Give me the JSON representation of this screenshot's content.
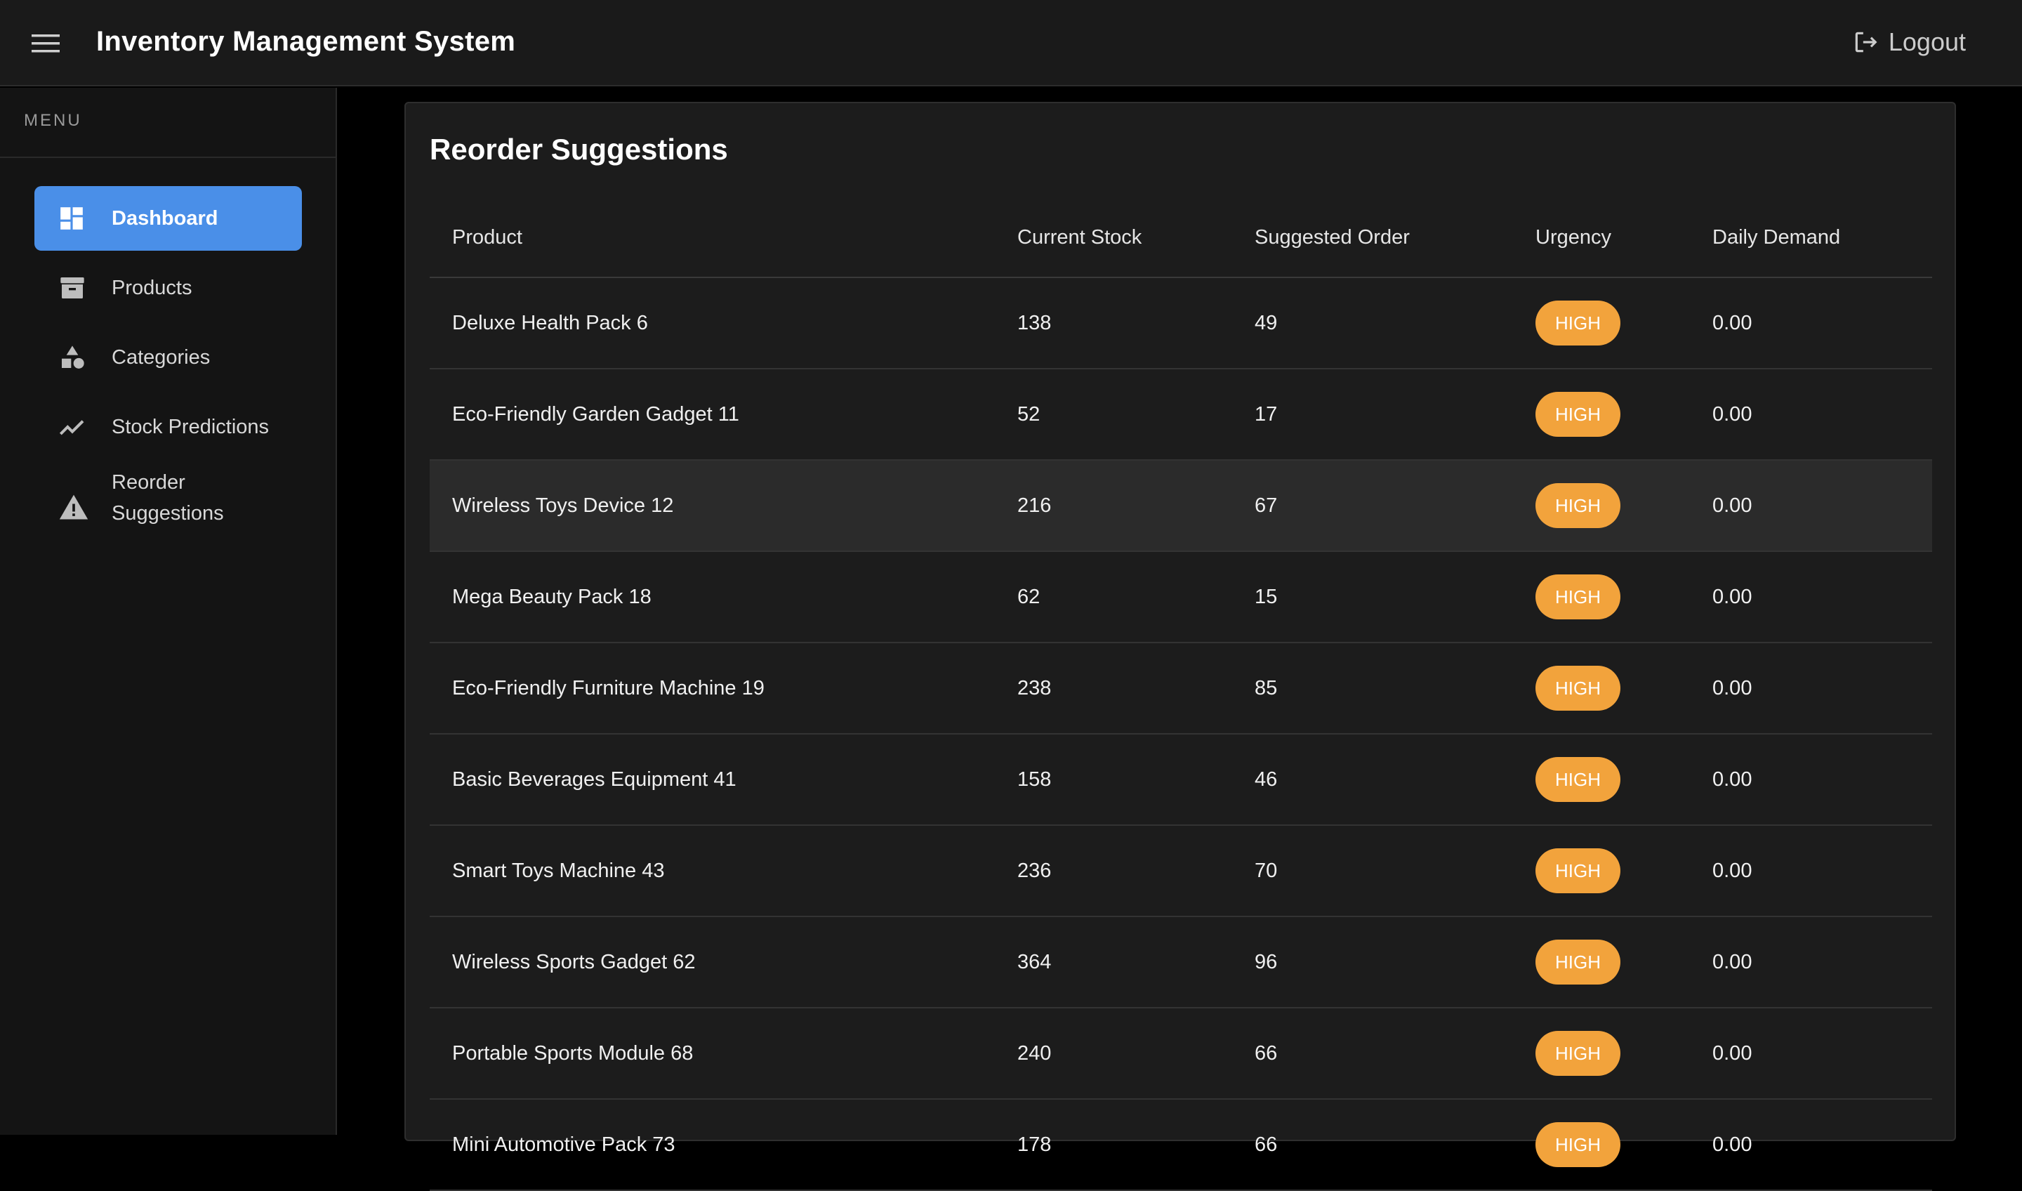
{
  "app": {
    "title": "Inventory Management System",
    "logout_label": "Logout"
  },
  "sidebar": {
    "header": "MENU",
    "items": [
      {
        "label": "Dashboard",
        "icon": "dashboard-icon",
        "active": true
      },
      {
        "label": "Products",
        "icon": "archive-box-icon",
        "active": false
      },
      {
        "label": "Categories",
        "icon": "shapes-icon",
        "active": false
      },
      {
        "label": "Stock Predictions",
        "icon": "trend-line-icon",
        "active": false
      },
      {
        "label": "Reorder Suggestions",
        "icon": "warning-icon",
        "active": false
      }
    ]
  },
  "main": {
    "card_title": "Reorder Suggestions",
    "columns": [
      "Product",
      "Current Stock",
      "Suggested Order",
      "Urgency",
      "Daily Demand"
    ],
    "rows": [
      {
        "product": "Deluxe Health Pack 6",
        "stock": "138",
        "order": "49",
        "urgency": "HIGH",
        "demand": "0.00"
      },
      {
        "product": "Eco-Friendly Garden Gadget 11",
        "stock": "52",
        "order": "17",
        "urgency": "HIGH",
        "demand": "0.00"
      },
      {
        "product": "Wireless Toys Device 12",
        "stock": "216",
        "order": "67",
        "urgency": "HIGH",
        "demand": "0.00"
      },
      {
        "product": "Mega Beauty Pack 18",
        "stock": "62",
        "order": "15",
        "urgency": "HIGH",
        "demand": "0.00"
      },
      {
        "product": "Eco-Friendly Furniture Machine 19",
        "stock": "238",
        "order": "85",
        "urgency": "HIGH",
        "demand": "0.00"
      },
      {
        "product": "Basic Beverages Equipment 41",
        "stock": "158",
        "order": "46",
        "urgency": "HIGH",
        "demand": "0.00"
      },
      {
        "product": "Smart Toys Machine 43",
        "stock": "236",
        "order": "70",
        "urgency": "HIGH",
        "demand": "0.00"
      },
      {
        "product": "Wireless Sports Gadget 62",
        "stock": "364",
        "order": "96",
        "urgency": "HIGH",
        "demand": "0.00"
      },
      {
        "product": "Portable Sports Module 68",
        "stock": "240",
        "order": "66",
        "urgency": "HIGH",
        "demand": "0.00"
      },
      {
        "product": "Mini Automotive Pack 73",
        "stock": "178",
        "order": "66",
        "urgency": "HIGH",
        "demand": "0.00"
      }
    ]
  },
  "colors": {
    "accent": "#4a8fe8",
    "urgency_high": "#f2a33c",
    "background": "#000000",
    "surface": "#1c1c1c"
  }
}
